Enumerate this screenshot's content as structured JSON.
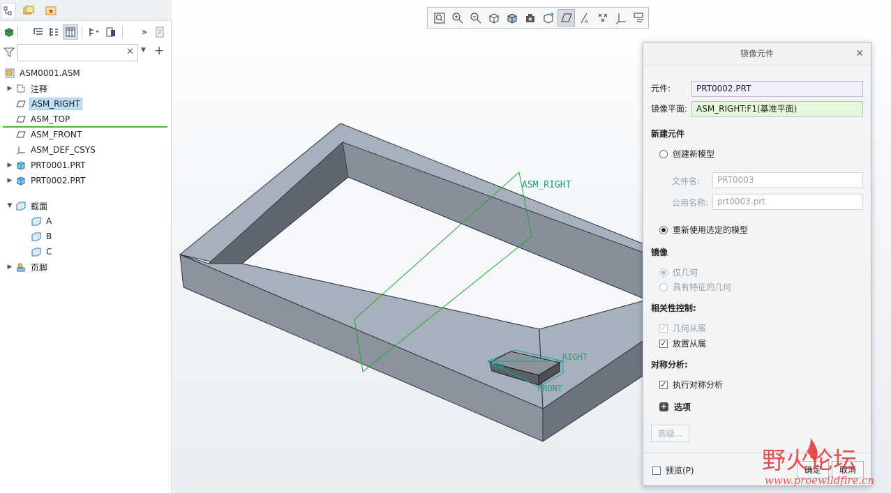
{
  "left_panel": {
    "search": {
      "value": "",
      "placeholder": ""
    },
    "tree": [
      {
        "label": "ASM0001.ASM"
      },
      {
        "label": "注释"
      },
      {
        "label": "ASM_RIGHT",
        "selected": true
      },
      {
        "label": "ASM_TOP"
      },
      {
        "label": "ASM_FRONT"
      },
      {
        "label": "ASM_DEF_CSYS"
      },
      {
        "label": "PRT0001.PRT"
      },
      {
        "label": "PRT0002.PRT"
      },
      {
        "label": "截面"
      },
      {
        "label": "A"
      },
      {
        "label": "B"
      },
      {
        "label": "C"
      },
      {
        "label": "页脚"
      }
    ]
  },
  "graphics": {
    "plane_label": "ASM_RIGHT",
    "part_labels": {
      "top": "TOP",
      "right": "RIGHT",
      "front": "FRONT"
    },
    "plane_color": "#22aa22",
    "datum_text_color": "#2a9a7a"
  },
  "dialog": {
    "title": "镜像元件",
    "component_label": "元件:",
    "component_value": "PRT0002.PRT",
    "plane_label": "镜像平面:",
    "plane_value": "ASM_RIGHT:F1(基准平面)",
    "new_component_header": "新建元件",
    "create_new_model": "创建新模型",
    "file_name_label": "文件名:",
    "file_name_value": "PRT0003",
    "common_name_label": "公用名称:",
    "common_name_value": "prt0003.prt",
    "reuse_selected_model": "重新使用选定的模型",
    "mirror_header": "镜像",
    "geometry_only": "仅几何",
    "geometry_with_features": "具有特征的几何",
    "dependency_header": "相关性控制:",
    "geometry_dependent": "几何从属",
    "placement_dependent": "放置从属",
    "symmetry_header": "对称分析:",
    "run_symmetry_analysis": "执行对称分析",
    "options_label": "选项",
    "advanced_button": "高级...",
    "preview_label": "预览(P)",
    "ok_button": "确定",
    "cancel_button": "取消"
  },
  "watermark": {
    "chinese": "野火论坛",
    "url": "www.proewildfire.cn",
    "color": "#e83d3d"
  }
}
